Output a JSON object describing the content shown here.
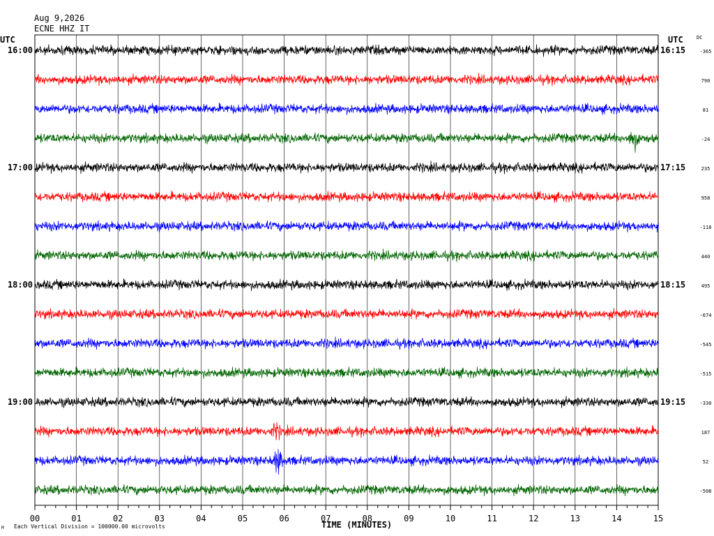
{
  "header": {
    "date": "Aug 9,2026",
    "station": "ECNE HHZ IT"
  },
  "utc_left": "UTC",
  "utc_right": "UTC",
  "dc_header": "DC",
  "footer": {
    "note": "Each Vertical Division = 100000.00 microvolts",
    "mark": "M"
  },
  "chart_data": {
    "type": "line",
    "title": "",
    "xlabel": "TIME (MINUTES)",
    "ylabel": "",
    "xlim": [
      0,
      15
    ],
    "x_ticks": [
      "00",
      "01",
      "02",
      "03",
      "04",
      "05",
      "06",
      "07",
      "08",
      "09",
      "10",
      "11",
      "12",
      "13",
      "14",
      "15"
    ],
    "grid": "vertical lines each minute",
    "trace_colors": [
      "#000000",
      "#ff0000",
      "#0000ff",
      "#006400"
    ],
    "left_time_labels": [
      {
        "trace": 0,
        "label": "16:00"
      },
      {
        "trace": 4,
        "label": "17:00"
      },
      {
        "trace": 8,
        "label": "18:00"
      },
      {
        "trace": 12,
        "label": "19:00"
      }
    ],
    "right_time_labels": [
      {
        "trace": 0,
        "label": "16:15"
      },
      {
        "trace": 4,
        "label": "17:15"
      },
      {
        "trace": 8,
        "label": "18:15"
      },
      {
        "trace": 12,
        "label": "19:15"
      }
    ],
    "dc_offsets": [
      "-365",
      "790",
      "81",
      "-24",
      "235",
      "958",
      "-118",
      "440",
      "495",
      "-674",
      "-545",
      "-515",
      "-330",
      "187",
      "52",
      "-508"
    ],
    "events": [
      {
        "trace": 3,
        "minute": 14.4,
        "amplitude": "large"
      },
      {
        "trace": 14,
        "minute": 5.85,
        "amplitude": "large"
      },
      {
        "trace": 13,
        "minute": 5.8,
        "amplitude": "medium"
      }
    ]
  }
}
